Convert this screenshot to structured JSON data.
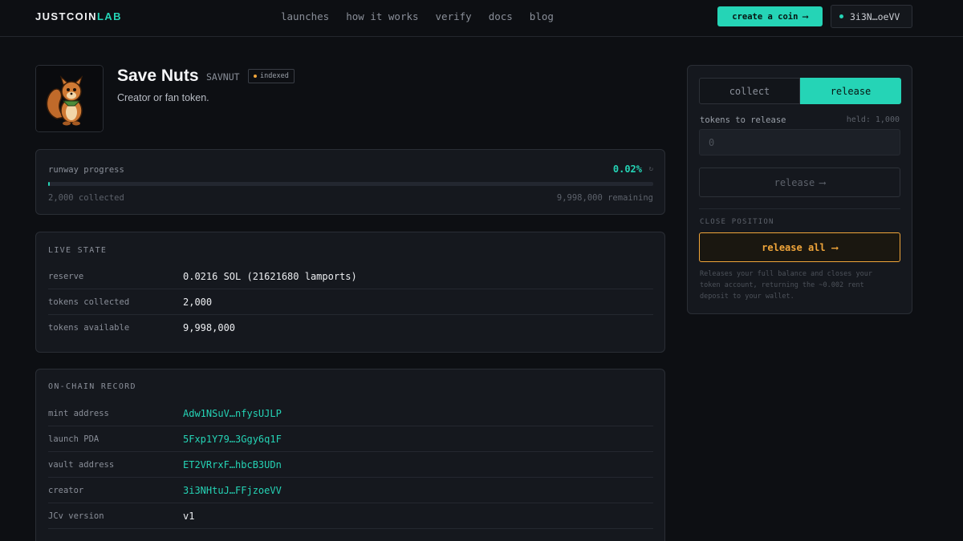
{
  "header": {
    "logo_main": "JUSTCOIN",
    "logo_accent": "LAB",
    "nav": [
      "launches",
      "how it works",
      "verify",
      "docs",
      "blog"
    ],
    "create_label": "create a coin",
    "wallet_label": "3i3N…oeVV"
  },
  "token": {
    "name": "Save Nuts",
    "symbol": "SAVNUT",
    "badge": "indexed",
    "description": "Creator or fan token."
  },
  "progress": {
    "label": "runway progress",
    "percent_text": "0.02%",
    "percent_value": 0.02,
    "collected": "2,000 collected",
    "remaining": "9,998,000 remaining"
  },
  "live_state": {
    "title": "LIVE STATE",
    "rows": [
      {
        "key": "reserve",
        "value": "0.0216 SOL (21621680 lamports)"
      },
      {
        "key": "tokens collected",
        "value": "2,000"
      },
      {
        "key": "tokens available",
        "value": "9,998,000"
      }
    ]
  },
  "record": {
    "title": "ON-CHAIN RECORD",
    "rows": [
      {
        "key": "mint address",
        "value": "Adw1NSuV…nfysUJLP"
      },
      {
        "key": "launch PDA",
        "value": "5Fxp1Y79…3Ggy6q1F"
      },
      {
        "key": "vault address",
        "value": "ET2VRrxF…hbcB3UDn"
      },
      {
        "key": "creator",
        "value": "3i3NHtuJ…FFjzoeVV"
      },
      {
        "key": "JCv version",
        "value": "v1"
      }
    ]
  },
  "panel": {
    "tab_collect": "collect",
    "tab_release": "release",
    "field_label": "tokens to release",
    "held": "held: 1,000",
    "placeholder": "0",
    "release_label": "release",
    "close_label": "CLOSE POSITION",
    "release_all_label": "release all",
    "note": "Releases your full balance and closes your token account, returning the ~0.002 rent deposit to your wallet."
  },
  "colors": {
    "accent": "#25d4b6",
    "warning": "#f0a53a",
    "background": "#0d0f13"
  }
}
